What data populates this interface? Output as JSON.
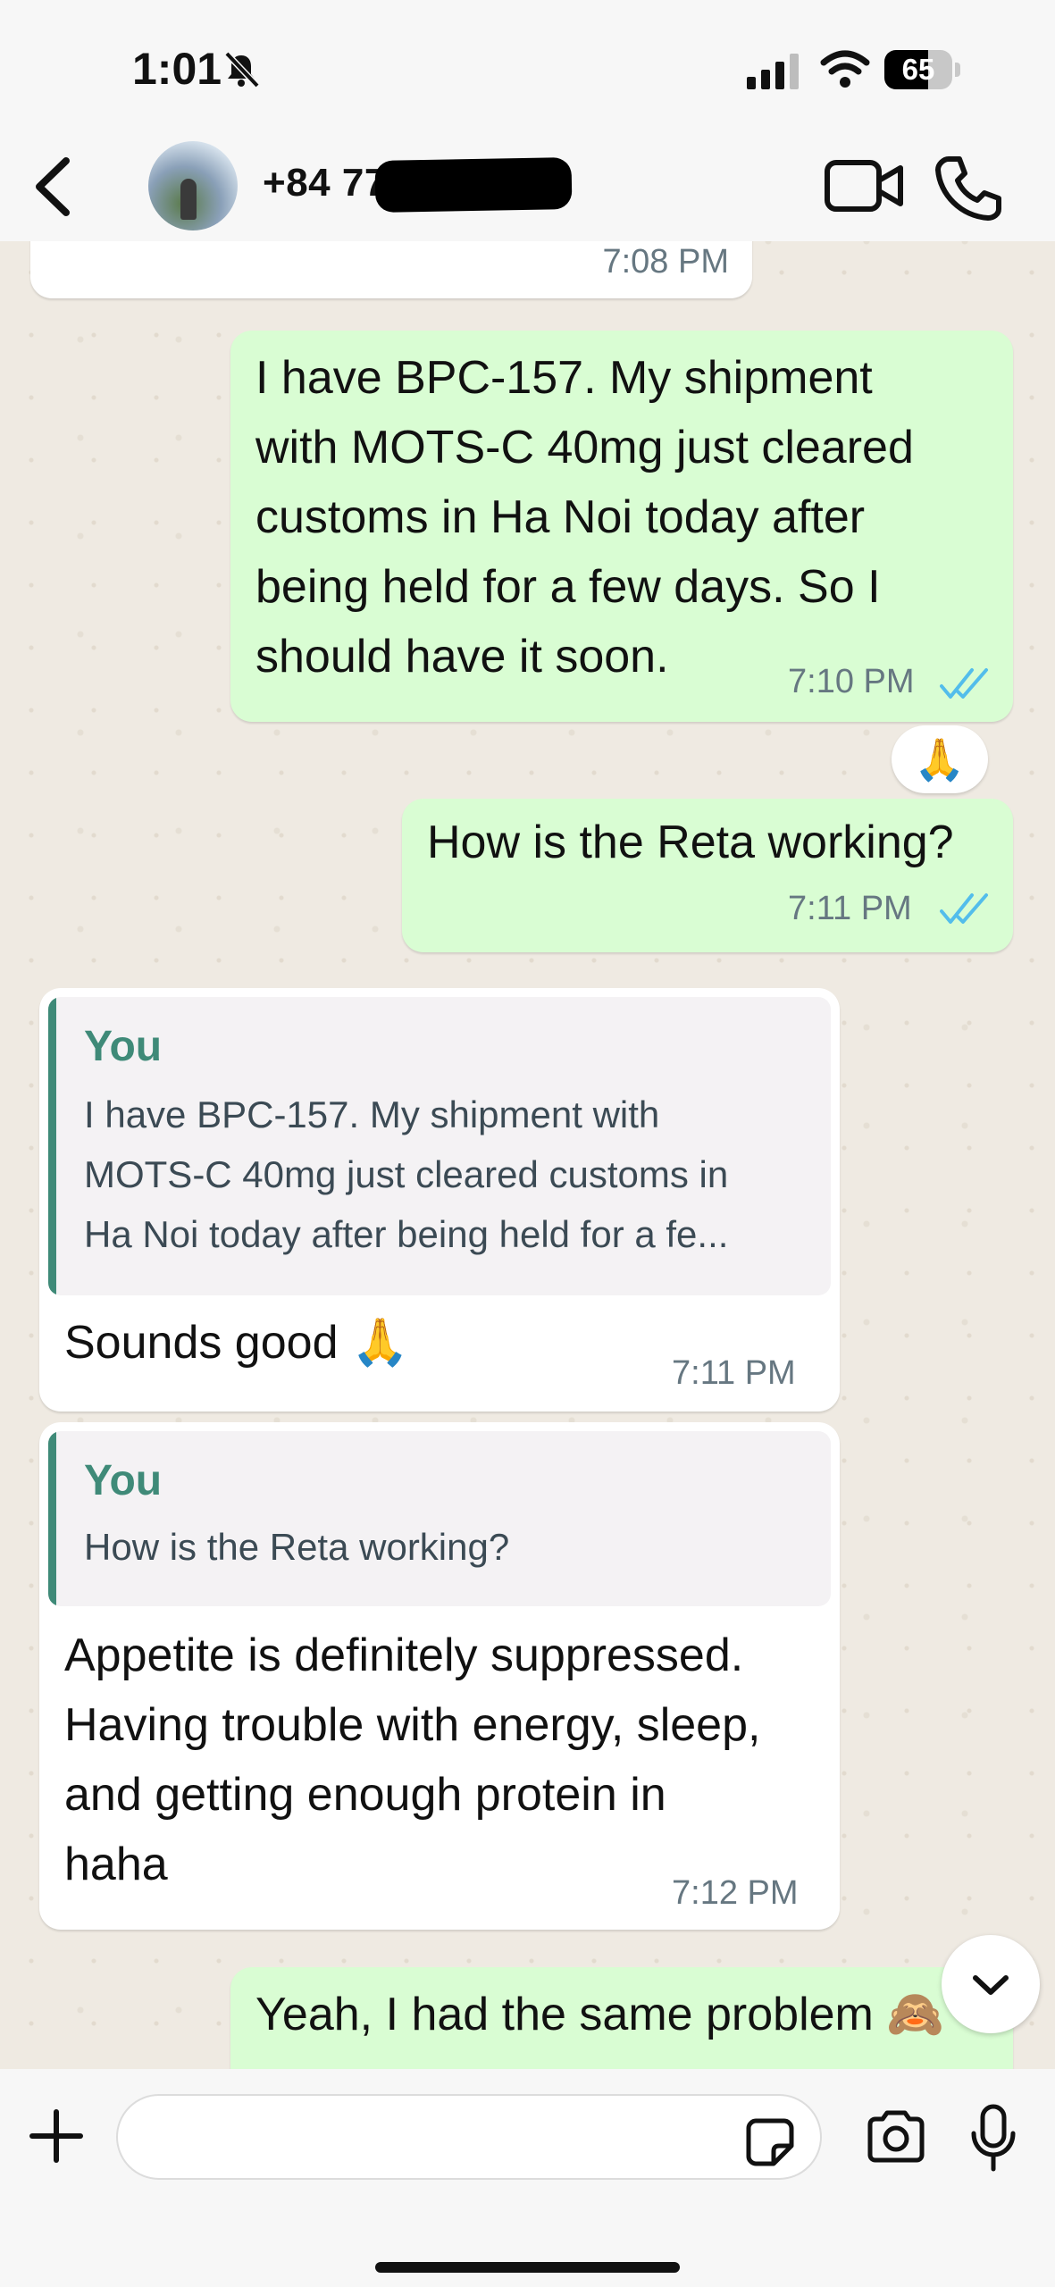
{
  "status_bar": {
    "time": "1:01",
    "battery": "65",
    "battery_level": 0.65,
    "icons": [
      "bell-slash-icon",
      "signal-icon",
      "wifi-icon",
      "battery-icon"
    ]
  },
  "header": {
    "contact_name": "+84 77",
    "contact_name_redacted": true,
    "icons": [
      "back-chevron-icon",
      "avatar",
      "video-call-icon",
      "phone-icon"
    ]
  },
  "messages": [
    {
      "id": "m0",
      "direction": "incoming",
      "time": "7:08 PM"
    },
    {
      "id": "m1",
      "direction": "outgoing",
      "text": "I have BPC-157. My shipment\nwith MOTS-C 40mg just cleared\ncustoms in Ha Noi today after\nbeing held for a few days. So I\nshould have it soon.",
      "time": "7:10 PM",
      "status": "read"
    },
    {
      "id": "m1_reaction",
      "emoji": "🙏"
    },
    {
      "id": "m2",
      "direction": "outgoing",
      "text": "How is the Reta working?",
      "time": "7:11 PM",
      "status": "read"
    },
    {
      "id": "m3",
      "direction": "incoming",
      "quote": {
        "author": "You",
        "text": "I have BPC-157. My shipment with\nMOTS-C 40mg just cleared customs in\nHa Noi today after being held for a fe..."
      },
      "text": "Sounds good 🙏",
      "time": "7:11 PM"
    },
    {
      "id": "m4",
      "direction": "incoming",
      "quote": {
        "author": "You",
        "text": "How is the Reta working?"
      },
      "text": "Appetite is definitely suppressed.\nHaving trouble with energy, sleep,\nand getting enough protein in\nhaha",
      "time": "7:12 PM"
    },
    {
      "id": "m5",
      "direction": "outgoing",
      "text": "Yeah, I had the same problem 🙈",
      "status": "read"
    }
  ],
  "composer": {
    "placeholder": "",
    "icons": [
      "plus-icon",
      "sticker-icon",
      "camera-icon",
      "microphone-icon"
    ]
  },
  "colors": {
    "chat_background": "#efeae2",
    "outgoing_bubble": "#d9fdd3",
    "incoming_bubble": "#ffffff",
    "quote_accent": "#3f8a78",
    "read_ticks": "#53bdeb",
    "timestamp": "#667781"
  }
}
